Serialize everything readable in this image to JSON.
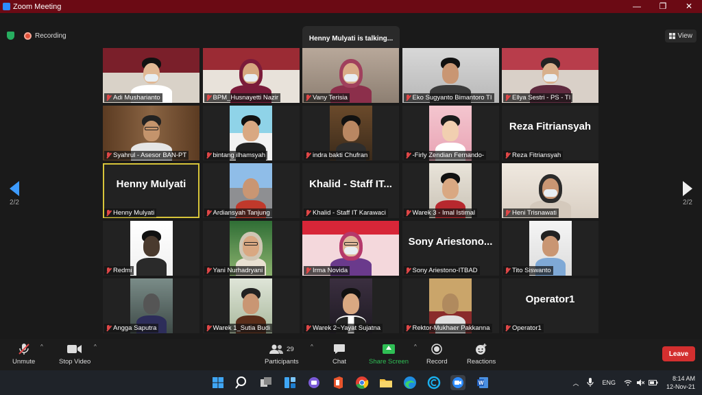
{
  "window": {
    "title": "Zoom Meeting"
  },
  "meeting": {
    "recording_label": "Recording",
    "talking": "Henny Mulyati is talking...",
    "view_label": "View",
    "page_left": "2/2",
    "page_right": "2/2"
  },
  "tiles": [
    {
      "name": "Adi Musharianto",
      "kind": "photo"
    },
    {
      "name": "BPM_Husnayetti Nazir",
      "kind": "photo"
    },
    {
      "name": "Vany Terisia",
      "kind": "photo"
    },
    {
      "name": "Eko Sugyanto Bimantoro TI",
      "kind": "photo"
    },
    {
      "name": "Ellya Sestri - PS - TI",
      "kind": "photo"
    },
    {
      "name": "Syahrul - Asesor BAN-PT",
      "kind": "photo"
    },
    {
      "name": "bintang ilhamsyah",
      "kind": "photo"
    },
    {
      "name": "indra bakti Chufran",
      "kind": "photo"
    },
    {
      "name": "-Firly Zendian Fernando-",
      "kind": "photo"
    },
    {
      "name": "Reza Fitriansyah",
      "kind": "text",
      "big": "Reza Fitriansyah"
    },
    {
      "name": "Henny Mulyati",
      "kind": "text",
      "big": "Henny Mulyati",
      "active": true
    },
    {
      "name": "Ardiansyah Tanjung",
      "kind": "photo"
    },
    {
      "name": "Khalid - Staff IT Karawaci",
      "kind": "text",
      "big": "Khalid - Staff IT..."
    },
    {
      "name": "Warek 3 - Imal Istimal",
      "kind": "photo"
    },
    {
      "name": "Heni Trisnawati",
      "kind": "photo"
    },
    {
      "name": "Redmi",
      "kind": "photo"
    },
    {
      "name": "Yani Nurhadryani",
      "kind": "photo"
    },
    {
      "name": "Irma Novida",
      "kind": "photo"
    },
    {
      "name": "Sony Ariestono-ITBAD",
      "kind": "text",
      "big": "Sony Ariestono..."
    },
    {
      "name": "Tito Siswanto",
      "kind": "photo"
    },
    {
      "name": "Angga Saputra",
      "kind": "photo"
    },
    {
      "name": "Warek 1_Sutia Budi",
      "kind": "photo"
    },
    {
      "name": "Warek 2~Yayat Sujatna",
      "kind": "photo"
    },
    {
      "name": "Rektor-Mukhaer Pakkanna",
      "kind": "photo"
    },
    {
      "name": "Operator1",
      "kind": "text",
      "big": "Operator1"
    }
  ],
  "toolbar": {
    "unmute": "Unmute",
    "stop_video": "Stop Video",
    "participants": "Participants",
    "participants_count": "29",
    "chat": "Chat",
    "share_screen": "Share Screen",
    "record": "Record",
    "reactions": "Reactions",
    "leave": "Leave"
  },
  "taskbar": {
    "lang": "ENG",
    "time": "8:14 AM",
    "date": "12-Nov-21"
  },
  "colors": {
    "titlebar": "#6b0a14",
    "share": "#2fbf55",
    "leave": "#d32f2f",
    "active_border": "#d8c53a"
  }
}
